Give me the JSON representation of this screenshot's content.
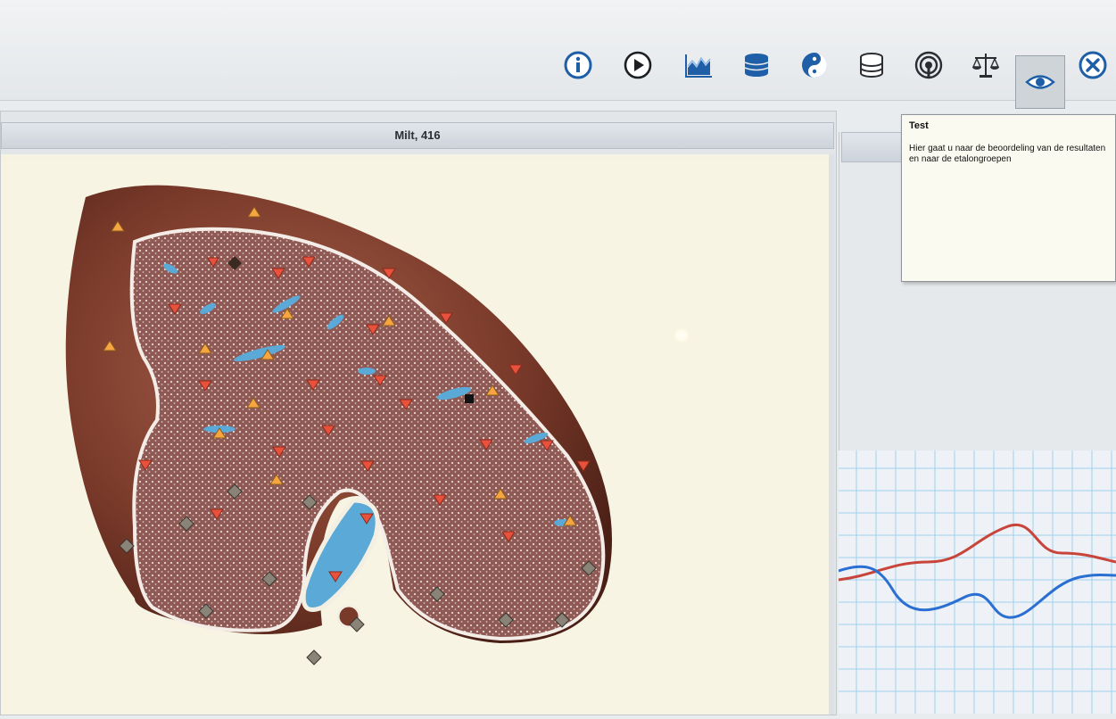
{
  "panel": {
    "title": "Milt, 416"
  },
  "tooltip": {
    "title": "Test",
    "text": "Hier gaat u naar de beoordeling van de resultaten\nen naar de etalongroepen"
  },
  "toolbar": {
    "accent_color": "#1f5fa8",
    "buttons": [
      {
        "icon": "info-icon"
      },
      {
        "icon": "play-icon"
      },
      {
        "icon": "wave-chart-icon"
      },
      {
        "icon": "database-stack-icon"
      },
      {
        "icon": "yin-yang-icon"
      },
      {
        "icon": "database-icon"
      },
      {
        "icon": "signal-broadcast-icon"
      },
      {
        "icon": "scales-icon"
      },
      {
        "icon": "eye-icon",
        "active": true
      },
      {
        "icon": "close-icon"
      }
    ]
  },
  "markers": {
    "colors": {
      "red_down": "#e8513b",
      "orange_up": "#f5a640",
      "gray_diamond": "#8a8378"
    }
  },
  "waveform": {
    "red_color": "#c8453b",
    "blue_color": "#2a6fd1"
  }
}
